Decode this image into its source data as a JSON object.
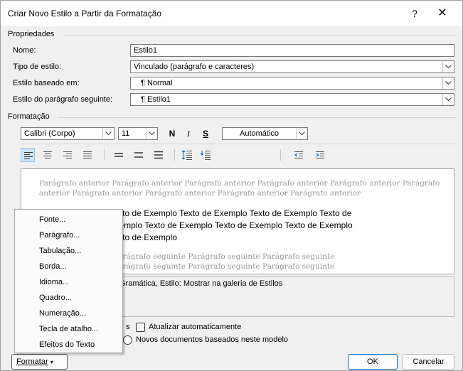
{
  "window": {
    "title": "Criar Novo Estilo a Partir da Formatação",
    "help": "?",
    "close": "✕"
  },
  "propriedades": {
    "heading": "Propriedades",
    "nome_label": "Nome:",
    "nome_value": "Estilo1",
    "tipo_label": "Tipo de estilo:",
    "tipo_value": "Vinculado (parágrafo e caracteres)",
    "baseado_label": "Estilo baseado em:",
    "baseado_value": "Normal",
    "seguinte_label": "Estilo do parágrafo seguinte:",
    "seguinte_value": "Estilo1"
  },
  "formatacao": {
    "heading": "Formatação",
    "font": "Calibri (Corpo)",
    "size": "11",
    "bold": "N",
    "italic": "I",
    "underline": "S",
    "color": "Automático"
  },
  "preview": {
    "previous": "Parágrafo anterior Parágrafo anterior Parágrafo anterior Parágrafo anterior Parágrafo anterior Parágrafo anterior Parágrafo anterior Parágrafo anterior Parágrafo anterior Parágrafo anterior",
    "sample_1": "Texto de Exemplo Texto de Exemplo Texto de Exemplo Texto de Exemplo Texto de",
    "sample_2": "Exemplo Texto de Exemplo Texto de Exemplo Texto de Exemplo Texto de Exemplo",
    "sample_3": "Texto de Exemplo Texto de Exemplo",
    "following_1": "Parágrafo seguinte Parágrafo seguinte Parágrafo seguinte Parágrafo seguinte",
    "following_2": "Parágrafo seguinte Parágrafo seguinte Parágrafo seguinte Parágrafo seguinte"
  },
  "description": "Gramática, Estilo: Mostrar na galeria de Estilos",
  "options": {
    "add_gallery_tail": "s",
    "auto_update": "Atualizar automaticamente",
    "new_docs": "Novos documentos baseados neste modelo"
  },
  "buttons": {
    "formatar": "Formatar",
    "ok": "OK",
    "cancel": "Cancelar"
  },
  "menu": {
    "items": [
      "Fonte...",
      "Parágrafo...",
      "Tabulação...",
      "Borda...",
      "Idioma...",
      "Quadro...",
      "Numeração...",
      "Tecla de atalho...",
      "Efeitos do Texto"
    ]
  },
  "colors": {
    "accent": "#0067c0",
    "dialog_bg": "#f0f0f0",
    "preview_grey": "#9a9a9a"
  }
}
